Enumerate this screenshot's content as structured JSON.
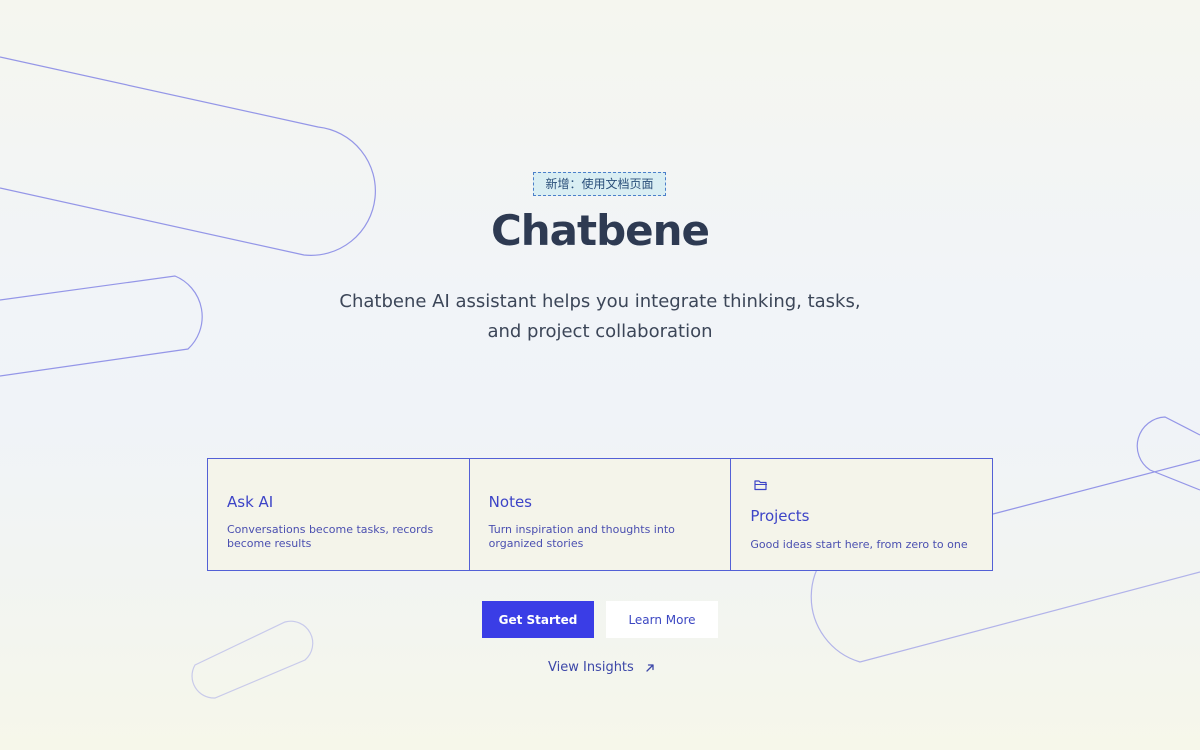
{
  "badge": {
    "text": "新增：使用文档页面"
  },
  "hero": {
    "title": "Chatbene",
    "subtitle": "Chatbene AI assistant helps you integrate thinking, tasks, and project collaboration"
  },
  "features": [
    {
      "title": "Ask AI",
      "description": "Conversations become tasks, records become results"
    },
    {
      "title": "Notes",
      "description": "Turn inspiration and thoughts into organized stories"
    },
    {
      "title": "Projects",
      "description": "Good ideas start here, from zero to one",
      "icon": "folder-icon"
    }
  ],
  "actions": {
    "primary_label": "Get Started",
    "secondary_label": "Learn More",
    "insights_label": "View Insights",
    "insights_icon": "arrow-up-right-icon"
  },
  "colors": {
    "accent": "#3a3de6",
    "title": "#2e3a52",
    "feature_text": "#3d44c7",
    "decor_line": "#7d7fe0"
  }
}
